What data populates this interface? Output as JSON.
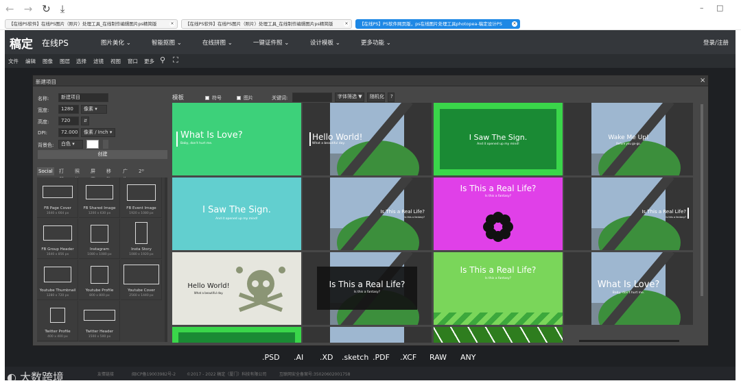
{
  "browser": {
    "tabs": [
      {
        "label": "【在线PS软件】在线PS图片（照片）处理工具_在线制作编辑图片ps精简版",
        "active": false
      },
      {
        "label": "【在线PS软件】在线PS图片（照片）处理工具_在线制作编辑图片ps精简版",
        "active": false
      },
      {
        "label": "【在线PS】PS软件网页版，ps在线图片处理工具photopea-稿定设计PS",
        "active": true
      }
    ]
  },
  "header": {
    "logo": "稿定",
    "subtitle": "在线PS",
    "menu": [
      "图片美化",
      "智能抠图",
      "在线拼图",
      "一键证件照",
      "设计模板",
      "更多功能"
    ],
    "login": "登录/注册"
  },
  "toolbar": {
    "items": [
      "文件",
      "编辑",
      "图像",
      "图层",
      "选择",
      "滤镜",
      "视图",
      "窗口",
      "更多"
    ]
  },
  "dialog": {
    "title": "新建项目",
    "name_label": "名称:",
    "name_value": "新建项目",
    "width_label": "宽度:",
    "width_value": "1280",
    "width_unit": "像素",
    "height_label": "高度:",
    "height_value": "720",
    "dpi_label": "DPI:",
    "dpi_value": "72.000",
    "dpi_unit": "像素 / Inch",
    "bg_label": "背景色:",
    "bg_value": "白色",
    "create": "创建",
    "preset_tabs": [
      "Social",
      "打印",
      "照片",
      "屏幕",
      "移动",
      "广告",
      "2ᴰ"
    ],
    "presets": [
      {
        "name": "FB Page Cover",
        "size": "1640 x 664 px"
      },
      {
        "name": "FB Shared Image",
        "size": "1200 x 630 px"
      },
      {
        "name": "FB Event Image",
        "size": "1920 x 1080 px"
      },
      {
        "name": "FB Group Header",
        "size": "1640 x 856 px"
      },
      {
        "name": "Instagram",
        "size": "1080 x 1080 px"
      },
      {
        "name": "Insta Story",
        "size": "1080 x 1920 px"
      },
      {
        "name": "Youtube Thumbnail",
        "size": "1280 x 720 px"
      },
      {
        "name": "Youtube Profile",
        "size": "800 x 800 px"
      },
      {
        "name": "Youtube Cover",
        "size": "2560 x 1440 px"
      },
      {
        "name": "Twitter Profile",
        "size": "400 x 400 px"
      },
      {
        "name": "Twitter Header",
        "size": "1500 x 500 px"
      }
    ],
    "templates_label": "模板",
    "symbols_label": "符号",
    "images_label": "图片",
    "keyword_label": "关键词:",
    "font_filter": "字体筛选 ▼",
    "random": "随机化",
    "help": "?",
    "templates": [
      {
        "title": "What Is Love?",
        "sub": "Baby, don't hurt me.",
        "bg": "#3dd17a"
      },
      {
        "title": "Hello World!",
        "sub": "What a beautiful day.",
        "bg": "photo"
      },
      {
        "title": "I Saw The Sign.",
        "sub": "And it opened up my mind!",
        "bg": "#1a8a34"
      },
      {
        "title": "Wake Me Up!",
        "sub": "Before you go-go.",
        "bg": "photo"
      },
      {
        "title": "I Saw The Sign.",
        "sub": "And it opened up my mind!",
        "bg": "#62cfcf"
      },
      {
        "title": "Is This a Real Life?",
        "sub": "Is this a fantasy?",
        "bg": "photo"
      },
      {
        "title": "Is This a Real Life?",
        "sub": "Is this a fantasy?",
        "bg": "#e040e8"
      },
      {
        "title": "Is This a Real Life?",
        "sub": "Is this a fantasy?",
        "bg": "photo"
      },
      {
        "title": "Hello World!",
        "sub": "What a beautiful day.",
        "bg": "#e6e6de"
      },
      {
        "title": "Is This a Real Life?",
        "sub": "Is this a fantasy?",
        "bg": "photo"
      },
      {
        "title": "Is This a Real Life?",
        "sub": "Is this a fantasy?",
        "bg": "#7ad65a"
      },
      {
        "title": "What Is Love?",
        "sub": "Baby, don't hurt me.",
        "bg": "photo"
      }
    ]
  },
  "formats": [
    ".PSD",
    ".AI",
    ".XD",
    ".sketch",
    ".PDF",
    ".XCF",
    "RAW",
    "ANY"
  ],
  "footer": {
    "links": "友情链接",
    "icp": "闽ICP备19003982号-2",
    "copyright": "©2017 - 2022 稿定（厦门）科技有限公司",
    "police": "互联网安全备案号:35020602001758"
  },
  "watermark": "大数跨境"
}
